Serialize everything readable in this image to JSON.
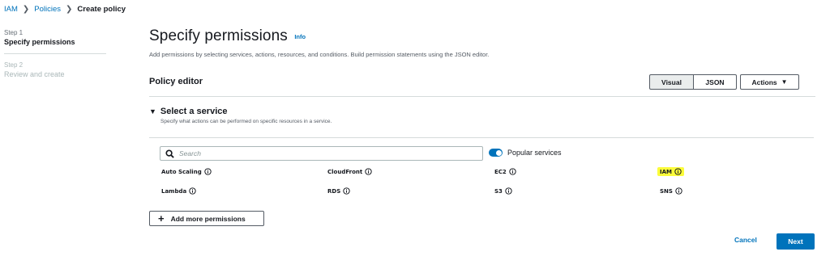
{
  "breadcrumb": {
    "items": [
      {
        "label": "IAM"
      },
      {
        "label": "Policies"
      },
      {
        "label": "Create policy"
      }
    ]
  },
  "steps": [
    {
      "num": "Step 1",
      "label": "Specify permissions",
      "active": true
    },
    {
      "num": "Step 2",
      "label": "Review and create",
      "active": false
    }
  ],
  "page": {
    "title": "Specify permissions",
    "info": "Info",
    "description": "Add permissions by selecting services, actions, resources, and conditions. Build permission statements using the JSON editor."
  },
  "editor": {
    "title": "Policy editor",
    "visual_label": "Visual",
    "json_label": "JSON",
    "actions_label": "Actions"
  },
  "service_section": {
    "title": "Select a service",
    "subtitle": "Specify what actions can be performed on specific resources in a service.",
    "search_placeholder": "Search",
    "popular_toggle_label": "Popular services",
    "services": [
      {
        "name": "Auto Scaling"
      },
      {
        "name": "CloudFront"
      },
      {
        "name": "EC2"
      },
      {
        "name": "IAM",
        "highlighted": true
      },
      {
        "name": "Lambda"
      },
      {
        "name": "RDS"
      },
      {
        "name": "S3"
      },
      {
        "name": "SNS"
      }
    ],
    "highlight_color": "#fbfc3a"
  },
  "add_permissions_label": "Add more permissions",
  "footer": {
    "cancel_label": "Cancel",
    "next_label": "Next"
  },
  "colors": {
    "link": "#0073bb",
    "primary": "#0073bb",
    "text": "#16191f",
    "muted": "#545b64"
  }
}
